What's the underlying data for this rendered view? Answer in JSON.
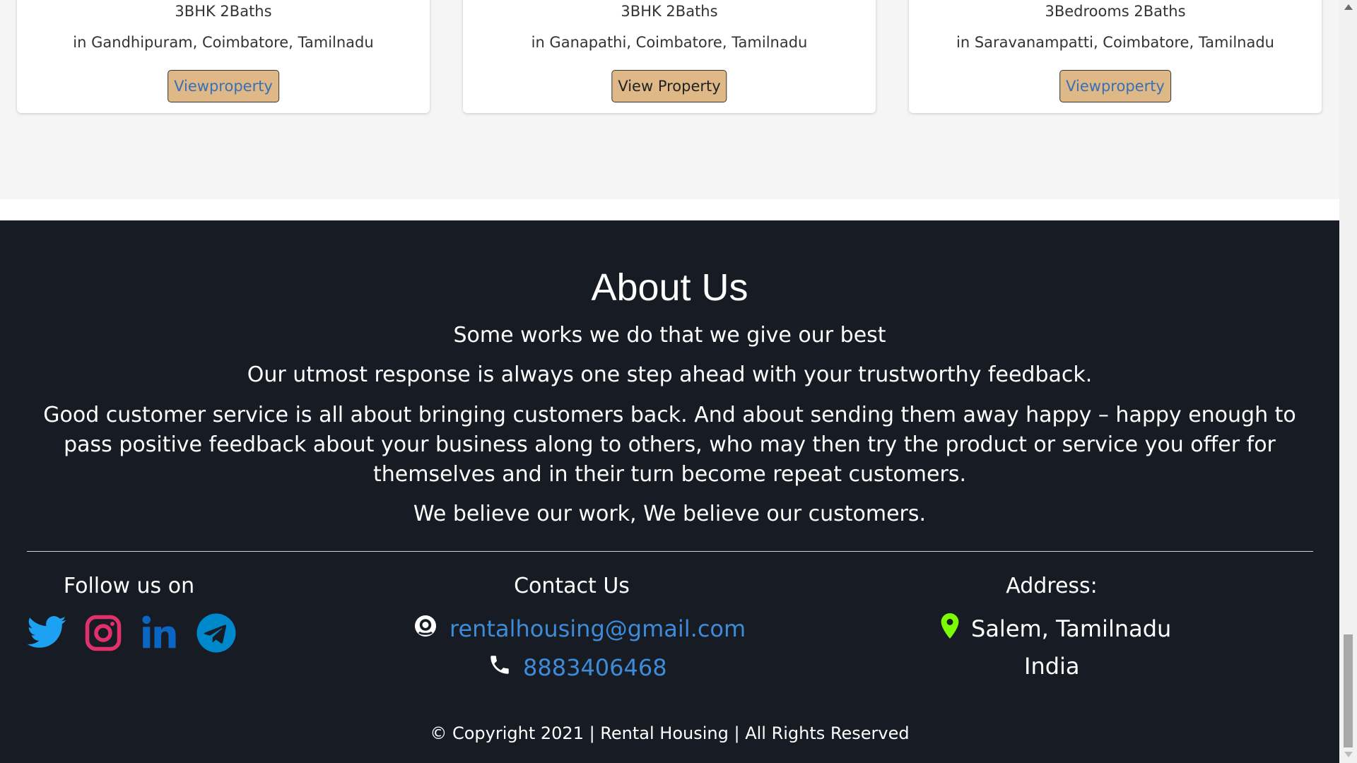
{
  "cards": [
    {
      "beds": "3BHK 2Baths",
      "location": "in Gandhipuram, Coimbatore, Tamilnadu",
      "button": "Viewproperty"
    },
    {
      "beds": "3BHK 2Baths",
      "location": "in Ganapathi, Coimbatore, Tamilnadu",
      "button": "View Property"
    },
    {
      "beds": "3Bedrooms 2Baths",
      "location": "in Saravanampatti, Coimbatore, Tamilnadu",
      "button": "Viewproperty"
    }
  ],
  "about": {
    "title": "About Us",
    "p1": "Some works we do that we give our best",
    "p2": "Our utmost response is always one step ahead with your trustworthy feedback.",
    "p3": "Good customer service is all about bringing customers back. And about sending them away happy – happy enough to pass positive feedback about your business along to others, who may then try the product or service you offer for themselves and in their turn become repeat customers.",
    "p4": "We believe our work, We believe our customers."
  },
  "follow": {
    "title": "Follow us on",
    "icons": [
      "twitter-icon",
      "instagram-icon",
      "linkedin-icon",
      "telegram-icon"
    ]
  },
  "contact": {
    "title": "Contact Us",
    "email": "rentalhousing@gmail.com",
    "phone": "8883406468"
  },
  "address": {
    "title": "Address:",
    "line1": "Salem, Tamilnadu",
    "line2": "India"
  },
  "copyright": "© Copyright 2021 | Rental Housing | All Rights Reserved",
  "colors": {
    "footer_bg": "#171c24",
    "button_bg": "#deb887",
    "link": "#3d8bd9",
    "twitter": "#1da1f2",
    "instagram": "#e1306c",
    "linkedin": "#0a66c2",
    "telegram": "#0088cc",
    "pin": "#7cfc00"
  }
}
